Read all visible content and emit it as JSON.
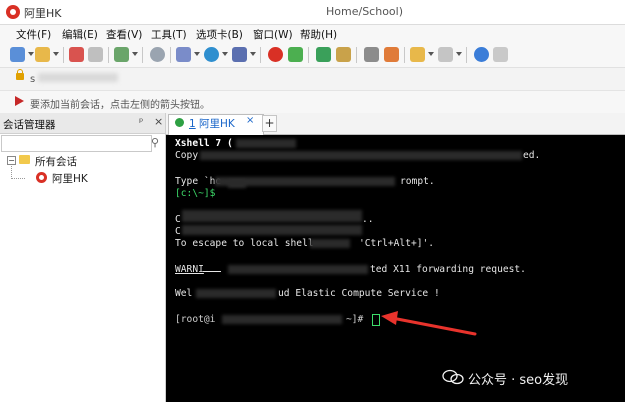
{
  "window": {
    "title": "阿里HK",
    "path_title": "Home/School)"
  },
  "menu": [
    "文件(F)",
    "编辑(E)",
    "查看(V)",
    "工具(T)",
    "选项卡(B)",
    "窗口(W)",
    "帮助(H)"
  ],
  "address_bar": {
    "value": "s"
  },
  "hint_bar": {
    "text": "要添加当前会话，点击左侧的箭头按钮。"
  },
  "session_manager": {
    "title": "会话管理器",
    "pin_glyph": "ᵖ",
    "close_glyph": "×",
    "search_placeholder": "",
    "tree": {
      "expander": "−",
      "root_label": "所有会话",
      "children": [
        {
          "label": "阿里HK"
        }
      ]
    }
  },
  "tabs": [
    {
      "index": "1",
      "label": "阿里HK",
      "close": "×",
      "active": true
    }
  ],
  "new_tab_glyph": "+",
  "terminal": {
    "lines": [
      "Xshell 7 (",
      "Copy",
      "ed.",
      "Type `he",
      "rompt.",
      "[c:\\~]$",
      "C",
      "..",
      "C",
      "To escape to local shell",
      "'Ctrl+Alt+]'.",
      "WARNI",
      "ted X11 forwarding request.",
      "Wel",
      "ud Elastic Compute Service !",
      "[root@i",
      "~]#"
    ]
  },
  "watermark": {
    "text": "公众号 · seo发现"
  },
  "colors": {
    "terminal_bg": "#000000",
    "terminal_fg": "#e6e6e6",
    "prompt_green": "#3ddc6a",
    "arrow_red": "#e8332c",
    "tab_blue": "#1a66c9"
  }
}
